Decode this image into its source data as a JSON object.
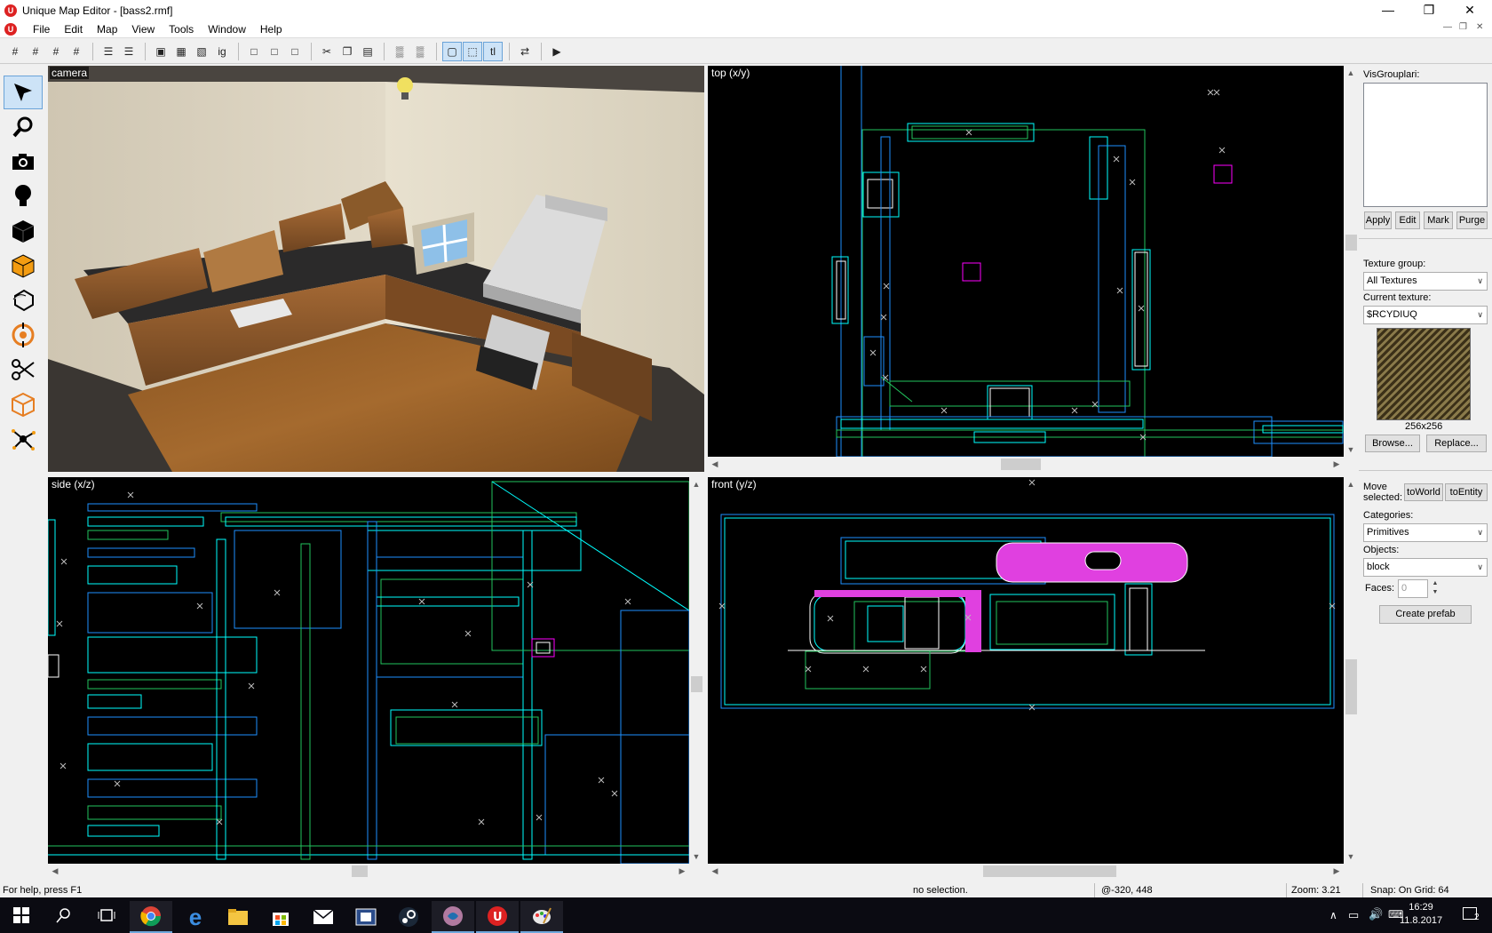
{
  "window": {
    "title": "Unique Map Editor - [bass2.rmf]"
  },
  "menu": {
    "items": [
      "File",
      "Edit",
      "Map",
      "View",
      "Tools",
      "Window",
      "Help"
    ]
  },
  "viewports": {
    "camera": {
      "label": "camera"
    },
    "top": {
      "label": "top (x/y)"
    },
    "side": {
      "label": "side (x/z)"
    },
    "front": {
      "label": "front (y/z)"
    }
  },
  "panel": {
    "visgroups_label": "VisGrouplari:",
    "apply": "Apply",
    "edit": "Edit",
    "mark": "Mark",
    "purge": "Purge",
    "texture_group_label": "Texture group:",
    "texture_group_value": "All Textures",
    "current_texture_label": "Current texture:",
    "current_texture_value": "$RCYDIUQ",
    "texture_size": "256x256",
    "browse": "Browse...",
    "replace": "Replace...",
    "move_selected_label": "Move selected:",
    "to_world": "toWorld",
    "to_entity": "toEntity",
    "categories_label": "Categories:",
    "categories_value": "Primitives",
    "objects_label": "Objects:",
    "objects_value": "block",
    "faces_label": "Faces:",
    "faces_value": "0",
    "create_prefab": "Create prefab"
  },
  "status": {
    "help": "For help, press F1",
    "selection": "no selection.",
    "coords": "@-320, 448",
    "zoom": "Zoom: 3.21",
    "snap": "Snap: On Grid: 64"
  },
  "taskbar": {
    "time": "16:29",
    "date": "11.8.2017",
    "notifications": "2"
  }
}
